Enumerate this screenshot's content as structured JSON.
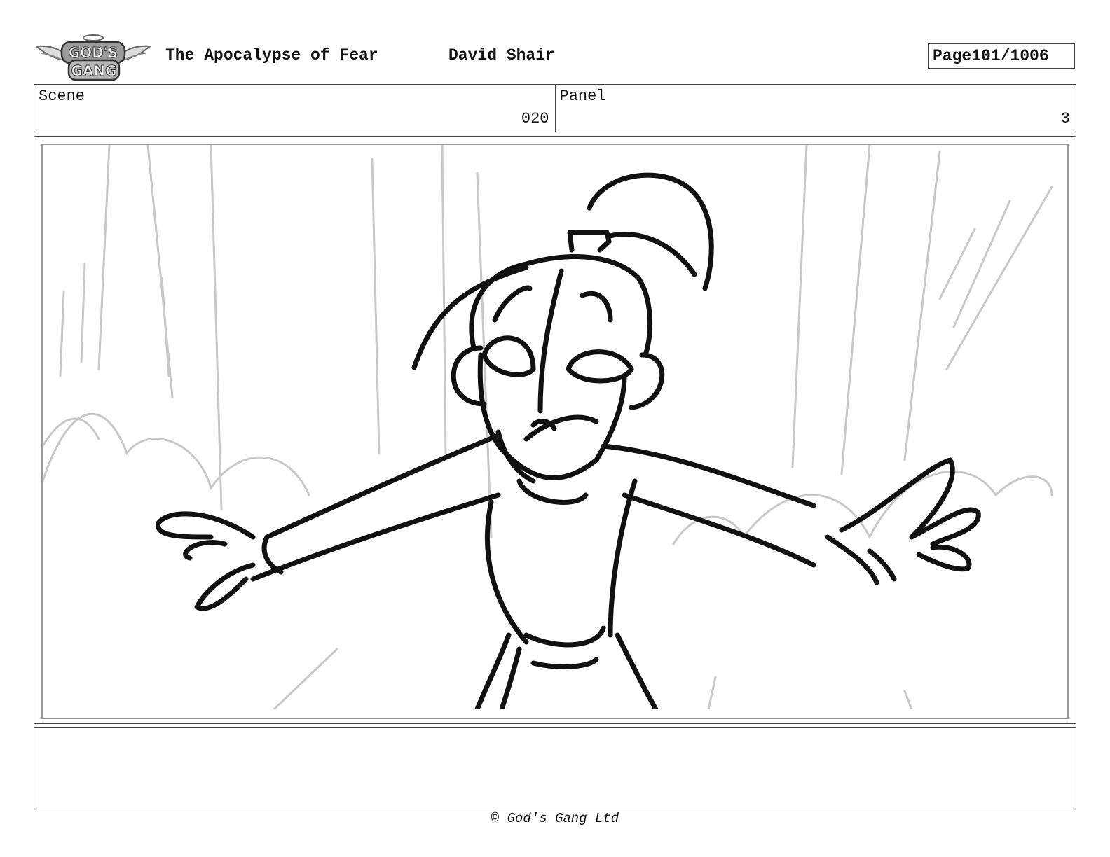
{
  "header": {
    "logo_text": "GOD'S GANG",
    "title": "The Apocalypse of Fear",
    "author": "David Shair",
    "page_label": "Page",
    "page_number": "101/1006"
  },
  "meta": {
    "scene_label": "Scene",
    "scene_value": "020",
    "panel_label": "Panel",
    "panel_value": "3"
  },
  "notes": {
    "text": ""
  },
  "footer": {
    "copyright": "© God's Gang Ltd"
  }
}
